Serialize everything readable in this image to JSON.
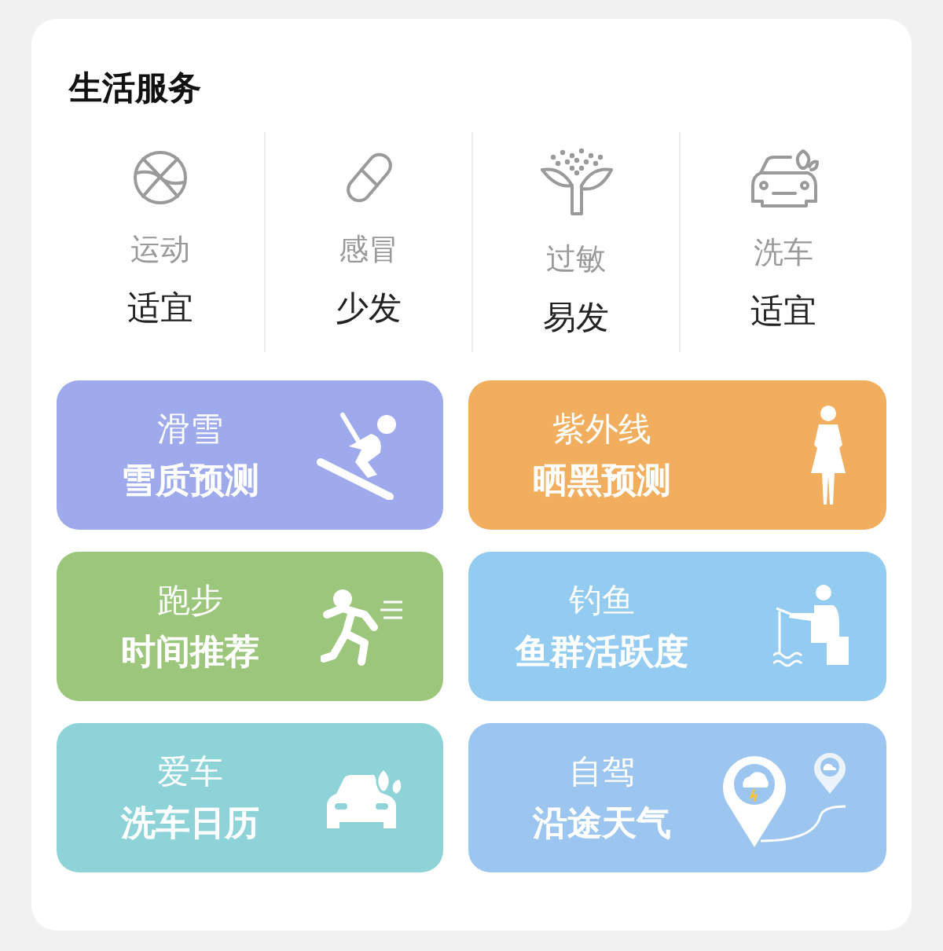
{
  "title": "生活服务",
  "indices": [
    {
      "kind": "basketball",
      "name": "运动",
      "value": "适宜"
    },
    {
      "kind": "pill",
      "name": "感冒",
      "value": "少发"
    },
    {
      "kind": "flower",
      "name": "过敏",
      "value": "易发"
    },
    {
      "kind": "car",
      "name": "洗车",
      "value": "适宜"
    }
  ],
  "cards": [
    {
      "kind": "ski",
      "color": "#9eaaec",
      "title": "滑雪",
      "subtitle": "雪质预测"
    },
    {
      "kind": "woman",
      "color": "#f0ae5e",
      "title": "紫外线",
      "subtitle": "晒黑预测"
    },
    {
      "kind": "runner",
      "color": "#9cc67c",
      "title": "跑步",
      "subtitle": "时间推荐"
    },
    {
      "kind": "fisher",
      "color": "#94cbf0",
      "title": "钓鱼",
      "subtitle": "鱼群活跃度"
    },
    {
      "kind": "carwash",
      "color": "#8dd3d8",
      "title": "爱车",
      "subtitle": "洗车日历"
    },
    {
      "kind": "pin",
      "color": "#9cc6f0",
      "title": "自驾",
      "subtitle": "沿途天气"
    }
  ]
}
